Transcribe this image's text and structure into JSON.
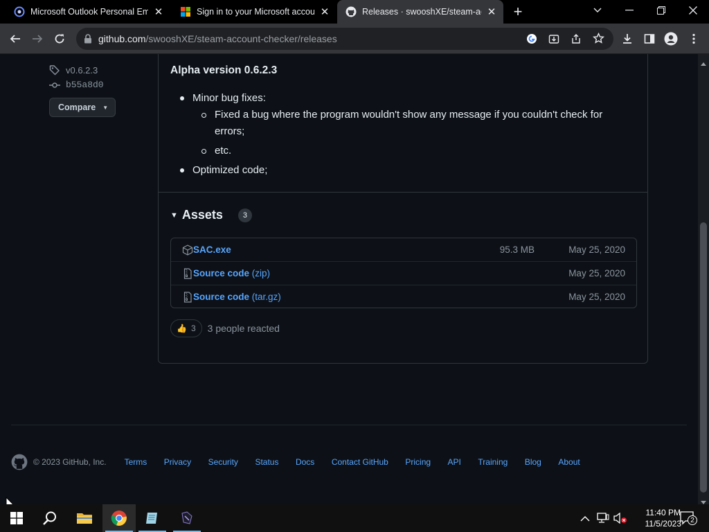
{
  "browser": {
    "tabs": [
      {
        "title": "Microsoft Outlook Personal Ema",
        "favicon": "outlook-icon",
        "active": false
      },
      {
        "title": "Sign in to your Microsoft accoun",
        "favicon": "microsoft-icon",
        "active": false
      },
      {
        "title": "Releases · swooshXE/steam-acco",
        "favicon": "github-icon",
        "active": true
      }
    ],
    "url_host": "github.com",
    "url_path": "/swooshXE/steam-account-checker/releases"
  },
  "sidebar": {
    "tag": "v0.6.2.3",
    "commit": "b55a8d0",
    "compare_label": "Compare"
  },
  "release": {
    "notes_title": "Alpha version 0.6.2.3",
    "bullets": {
      "b1": "Minor bug fixes:",
      "b1_sub1_line1": "Fixed a bug where the program wouldn't show any message if you couldn't check for",
      "b1_sub1_line2": "errors;",
      "b1_sub2": "etc.",
      "b2": "Optimized code;"
    },
    "assets_title": "Assets",
    "assets_count": "3",
    "assets": [
      {
        "name": "SAC.exe",
        "suffix": "",
        "size": "95.3 MB",
        "date": "May 25, 2020",
        "icon": "package-icon"
      },
      {
        "name": "Source code",
        "suffix": " (zip)",
        "size": "",
        "date": "May 25, 2020",
        "icon": "file-zip-icon"
      },
      {
        "name": "Source code",
        "suffix": " (tar.gz)",
        "size": "",
        "date": "May 25, 2020",
        "icon": "file-zip-icon"
      }
    ],
    "reaction_emoji": "👍",
    "reaction_count": "3",
    "reaction_text": "3 people reacted"
  },
  "footer": {
    "copyright": "© 2023 GitHub, Inc.",
    "links": [
      "Terms",
      "Privacy",
      "Security",
      "Status",
      "Docs",
      "Contact GitHub",
      "Pricing",
      "API",
      "Training",
      "Blog",
      "About"
    ]
  },
  "taskbar": {
    "time": "11:40 PM",
    "date": "11/5/2023",
    "notification_count": "2"
  },
  "colors": {
    "page_bg": "#0d1117",
    "link": "#58a6ff",
    "muted": "#8b949e",
    "border": "#30363d"
  }
}
